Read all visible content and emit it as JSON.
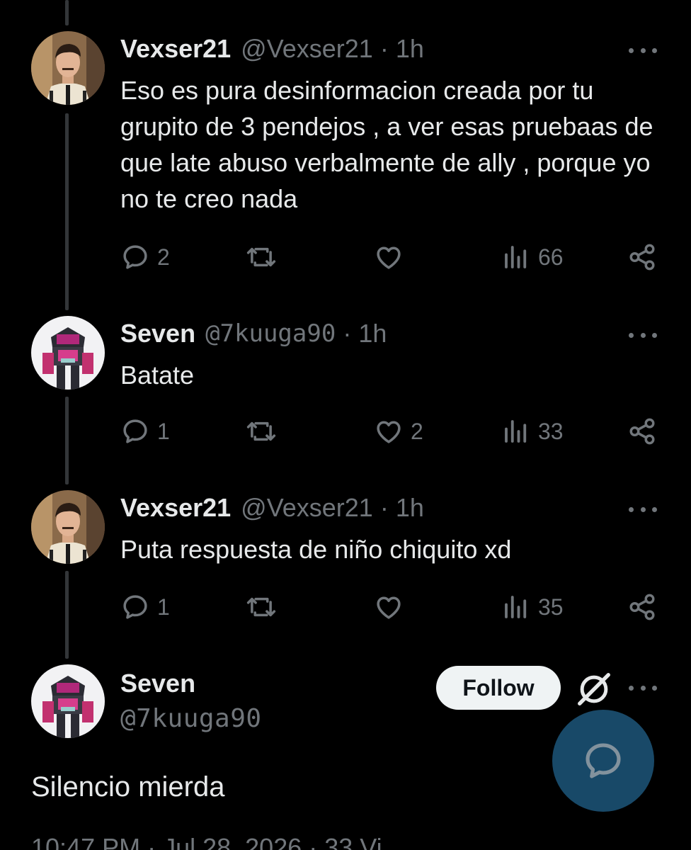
{
  "replies": [
    {
      "display_name": "Vexser21",
      "handle": "@Vexser21",
      "separator": "·",
      "time": "1h",
      "text": "Eso es pura desinformacion creada por tu grupito de 3 pendejos , a ver esas pruebaas de que late abuso verbalmente de ally , porque yo no te creo nada",
      "replies_count": "2",
      "retweets_count": "",
      "likes_count": "",
      "views_count": "66"
    },
    {
      "display_name": "Seven",
      "handle": "@7kuuga90",
      "separator": "·",
      "time": "1h",
      "text": "Batate",
      "replies_count": "1",
      "retweets_count": "",
      "likes_count": "2",
      "views_count": "33"
    },
    {
      "display_name": "Vexser21",
      "handle": "@Vexser21",
      "separator": "·",
      "time": "1h",
      "text": "Puta respuesta de niño chiquito xd",
      "replies_count": "1",
      "retweets_count": "",
      "likes_count": "",
      "views_count": "35"
    }
  ],
  "main_tweet": {
    "display_name": "Seven",
    "handle": "@7kuuga90",
    "follow_label": "Follow",
    "text": "Silencio mierda",
    "meta": "10:47 PM · Jul 28, 2026 · 33 Vi"
  },
  "icons": {
    "reply": "reply-icon",
    "retweet": "retweet-icon",
    "like": "heart-icon",
    "views": "views-icon",
    "share": "share-icon",
    "more": "more-icon",
    "grok": "grok-icon",
    "compose": "compose-reply-icon"
  },
  "colors": {
    "background": "#000000",
    "text_primary": "#e7e9ea",
    "text_secondary": "#71767b",
    "fab": "#1a4d6e",
    "follow_bg": "#eff3f4"
  }
}
